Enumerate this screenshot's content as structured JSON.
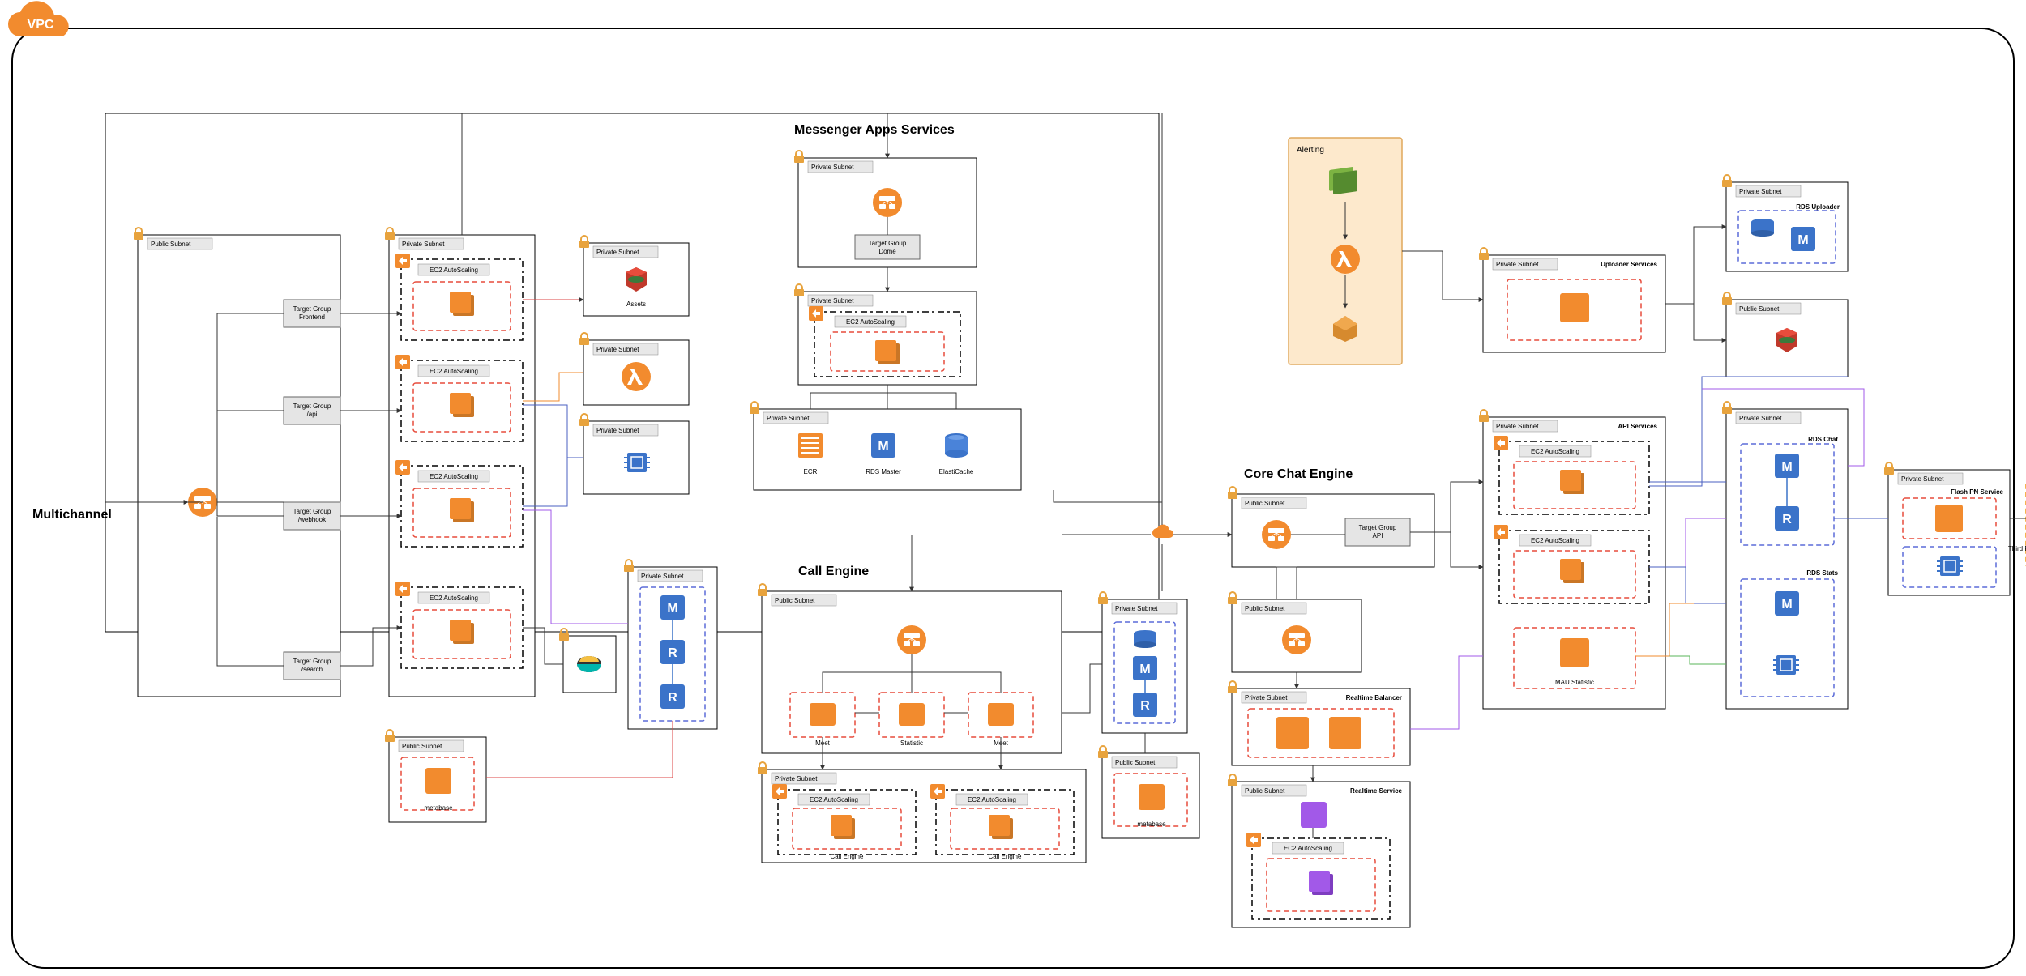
{
  "vpc_label": "VPC",
  "section_multichannel": "Multichannel",
  "section_messenger": "Messenger Apps Services",
  "section_call": "Call Engine",
  "section_core": "Core Chat Engine",
  "subnet_public": "Public Subnet",
  "subnet_private": "Private Subnet",
  "target_groups": {
    "frontend": "Target Group\nFrontend",
    "api_mc": "Target Group\n/api",
    "webhook": "Target Group\n/webhook",
    "search": "Target Group\n/search",
    "dome": "Target Group\nDome",
    "api_core": "Target Group\nAPI"
  },
  "ec2_autoscaling": "EC2 AutoScaling",
  "services": {
    "metabase": "metabase",
    "statistic": "Statistic",
    "meet1": "Meet",
    "meet2": "Meet",
    "call_engine": "Call Engine",
    "realtime_balancer": "Realtime Balancer",
    "realtime_service": "Realtime Service",
    "api_services": "API Services",
    "uploader_services": "Uploader Services",
    "mau_statistic": "MAU Statistic",
    "flash_pn": "Flash PN Service",
    "third_party": "Third Party ( FCM/ APNS )"
  },
  "resources": {
    "assets": "Assets",
    "ecr": "ECR",
    "rds_master": "RDS Master",
    "elasticache": "ElastiCache",
    "rds_uploader": "RDS Uploader",
    "rds_chat": "RDS Chat",
    "rds_stats": "RDS Stats"
  },
  "alerting": {
    "title": "Alerting"
  },
  "colors": {
    "orange": "#f28b2e",
    "blue": "#3b73c9",
    "green": "#7cb342",
    "purple": "#a259e8",
    "red_dash": "#e74c3c",
    "cloud": "#f28b2e"
  }
}
